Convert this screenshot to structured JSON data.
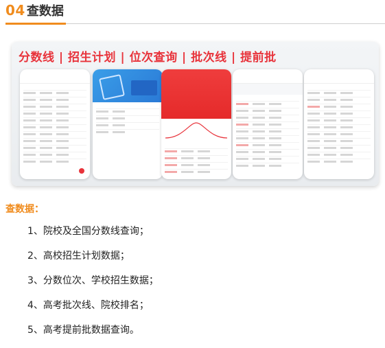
{
  "header": {
    "number": "04",
    "title": "查数据"
  },
  "banner": {
    "headline": "分数线 | 招生计划 | 位次查询 | 批次线 | 提前批"
  },
  "section": {
    "subtitle": "查数据：",
    "items": [
      "1、院校及全国分数线查询；",
      "2、高校招生计划数据；",
      "3、分数位次、学校招生数据；",
      "4、高考批次线、院校排名；",
      "5、高考提前批数据查询。"
    ]
  },
  "colors": {
    "accent": "#f08c1e",
    "banner_red": "#e8333b",
    "divider": "#cfcfcf"
  }
}
